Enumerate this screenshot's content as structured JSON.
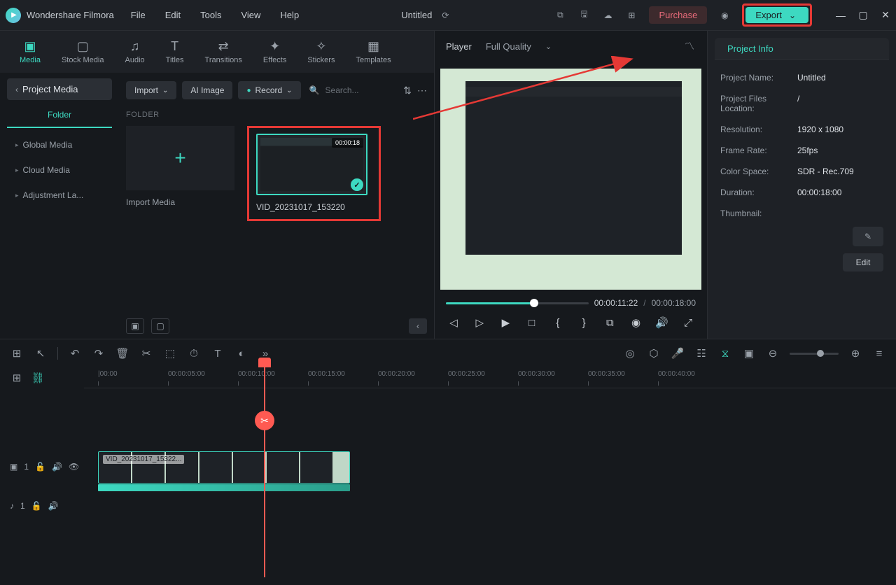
{
  "app": {
    "name": "Wondershare Filmora",
    "document": "Untitled"
  },
  "menu": {
    "items": [
      "File",
      "Edit",
      "Tools",
      "View",
      "Help"
    ]
  },
  "header": {
    "purchase": "Purchase",
    "export": "Export"
  },
  "toolTabs": [
    {
      "label": "Media",
      "icon": "▣"
    },
    {
      "label": "Stock Media",
      "icon": "▢"
    },
    {
      "label": "Audio",
      "icon": "♫"
    },
    {
      "label": "Titles",
      "icon": "T"
    },
    {
      "label": "Transitions",
      "icon": "⇄"
    },
    {
      "label": "Effects",
      "icon": "✦"
    },
    {
      "label": "Stickers",
      "icon": "✧"
    },
    {
      "label": "Templates",
      "icon": "▦"
    }
  ],
  "sidebar": {
    "projectMedia": "Project Media",
    "folder": "Folder",
    "items": [
      "Global Media",
      "Cloud Media",
      "Adjustment La..."
    ]
  },
  "contentBar": {
    "import": "Import",
    "aiImage": "AI Image",
    "record": "Record",
    "searchPlaceholder": "Search..."
  },
  "folderLabel": "FOLDER",
  "importTile": "Import Media",
  "clip": {
    "name": "VID_20231017_153220",
    "duration": "00:00:18"
  },
  "player": {
    "label": "Player",
    "quality": "Full Quality",
    "current": "00:00:11:22",
    "total": "00:00:18:00"
  },
  "projectInfo": {
    "tab": "Project Info",
    "rows": [
      {
        "label": "Project Name:",
        "value": "Untitled"
      },
      {
        "label": "Project Files Location:",
        "value": "/"
      },
      {
        "label": "Resolution:",
        "value": "1920 x 1080"
      },
      {
        "label": "Frame Rate:",
        "value": "25fps"
      },
      {
        "label": "Color Space:",
        "value": "SDR - Rec.709"
      },
      {
        "label": "Duration:",
        "value": "00:00:18:00"
      },
      {
        "label": "Thumbnail:",
        "value": ""
      }
    ],
    "edit": "Edit"
  },
  "timeline": {
    "ticks": [
      "|00:00",
      "00:00:05:00",
      "00:00:10:00",
      "00:00:15:00",
      "00:00:20:00",
      "00:00:25:00",
      "00:00:30:00",
      "00:00:35:00",
      "00:00:40:00"
    ],
    "clipLabel": "VID_20231017_15322..."
  }
}
